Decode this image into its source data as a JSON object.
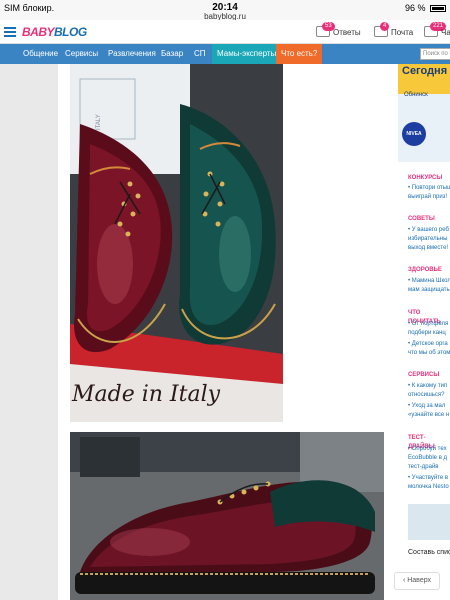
{
  "status": {
    "carrier": "SIM блокир.",
    "time": "20:14",
    "url": "babyblog.ru",
    "battery": "96 %"
  },
  "header": {
    "logo_part1": "BABY",
    "logo_part2": "BLOG",
    "answers_label": "Ответы",
    "answers_count": "53",
    "mail_label": "Почта",
    "mail_count": "4",
    "third_count": "221",
    "third_label": "Ча"
  },
  "nav": {
    "items": [
      "Общение",
      "Сервисы",
      "Развлечения",
      "Базар",
      "СП",
      "Мамы-эксперты",
      "Что есть?"
    ],
    "search_placeholder": "Поиск по блогам"
  },
  "photo1": {
    "caption": "Made in Italy",
    "paper_text": "ITALY"
  },
  "ad": {
    "headline": "Сегодня",
    "city": "Обнинск",
    "brand": "NIVEA"
  },
  "sidebar": {
    "sections": [
      {
        "title": "КОНКУРСЫ",
        "items": [
          "• Повтори отыщ",
          "выиграй приз!"
        ]
      },
      {
        "title": "СОВЕТЫ",
        "items": [
          "• У вашего реб",
          "избирательны",
          "выход вместе!"
        ]
      },
      {
        "title": "ЗДОРОВЬЕ",
        "items": [
          "• Мамина Школ",
          "мам защищать"
        ]
      },
      {
        "title": "ЧТО ПОЧИТАТЬ",
        "items": [
          "• От портфеля",
          "подбери канц",
          "• Детское орга",
          "что мы об этом"
        ]
      },
      {
        "title": "СЕРВИСЫ",
        "items": [
          "• К какому тип",
          "относишься?",
          "• Уход за мал",
          "«узнайте все н"
        ]
      },
      {
        "title": "ТЕСТ-ДРАЙВЫ",
        "items": [
          "• Опробуй тех",
          "EcoBubble в д",
          "тест-драйв",
          "• Участвуйте в",
          "молочка Nesto"
        ]
      }
    ],
    "bottom_text": "Составь спис"
  },
  "back_button": "Наверх",
  "colors": {
    "brand_pink": "#e8307a",
    "brand_blue": "#1a6fb3",
    "nav_blue": "#3a84c4",
    "nav_teal": "#1aa8b8",
    "nav_orange": "#f06a2a"
  }
}
